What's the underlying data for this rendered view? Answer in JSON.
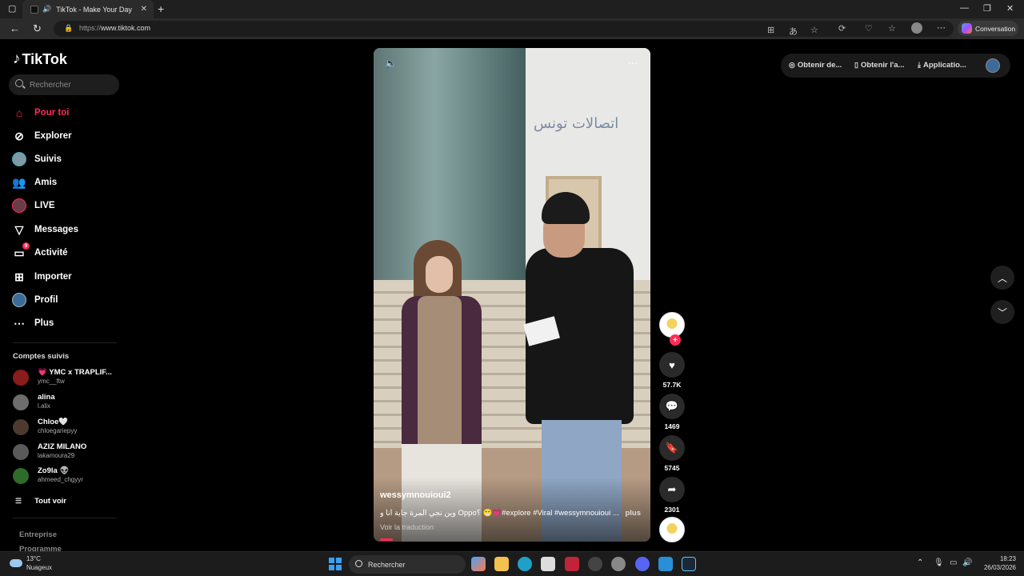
{
  "browser": {
    "tab_title": "TikTok - Make Your Day",
    "url_protocol": "https://",
    "url_host": "www.tiktok.com",
    "conversation_label": "Conversation"
  },
  "sidebar": {
    "logo_text": "TikTok",
    "search_placeholder": "Rechercher",
    "nav": [
      {
        "label": "Pour toi",
        "icon": "home-icon",
        "active": true
      },
      {
        "label": "Explorer",
        "icon": "compass-icon"
      },
      {
        "label": "Suivis",
        "icon": "following-avatar-icon"
      },
      {
        "label": "Amis",
        "icon": "friends-icon"
      },
      {
        "label": "LIVE",
        "icon": "live-icon"
      },
      {
        "label": "Messages",
        "icon": "send-icon"
      },
      {
        "label": "Activité",
        "icon": "activity-icon",
        "badge": "9"
      },
      {
        "label": "Importer",
        "icon": "upload-icon"
      },
      {
        "label": "Profil",
        "icon": "profile-icon"
      },
      {
        "label": "Plus",
        "icon": "more-icon"
      }
    ],
    "following_title": "Comptes suivis",
    "following": [
      {
        "name": "💗 YMC x TRAPLIF...",
        "user": "ymc__ftw"
      },
      {
        "name": "alina",
        "user": "l.alix"
      },
      {
        "name": "Chloe🤍",
        "user": "chloegariepyy"
      },
      {
        "name": "AZIZ MILANO",
        "user": "lakamoura29"
      },
      {
        "name": "Zo9la 👽",
        "user": "ahmeed_chgyyr"
      }
    ],
    "see_all": "Tout voir",
    "footer": [
      "Entreprise",
      "Programme"
    ]
  },
  "video": {
    "author": "wessymnouioui2",
    "description": "وين نجي المرة جاية أنا و Oppo؟ 😁💗#explore #Viral #wessymnouioui ...",
    "more_label": "plus",
    "translate_label": "Voir la traduction",
    "progress": 0.05,
    "sign_text": "اتصالات تونس"
  },
  "actions": {
    "likes": "57.7K",
    "comments": "1469",
    "saves": "5745",
    "shares": "2301"
  },
  "topbar": {
    "coins": "Obtenir de...",
    "app": "Obtenir l'a...",
    "desktop_app": "Applicatio..."
  },
  "taskbar": {
    "temperature": "13°C",
    "weather": "Nuageux",
    "search_label": "Rechercher",
    "time": "18:23",
    "date": "26/03/2026"
  },
  "colors": {
    "accent": "#fe2c55",
    "background": "#000000"
  }
}
